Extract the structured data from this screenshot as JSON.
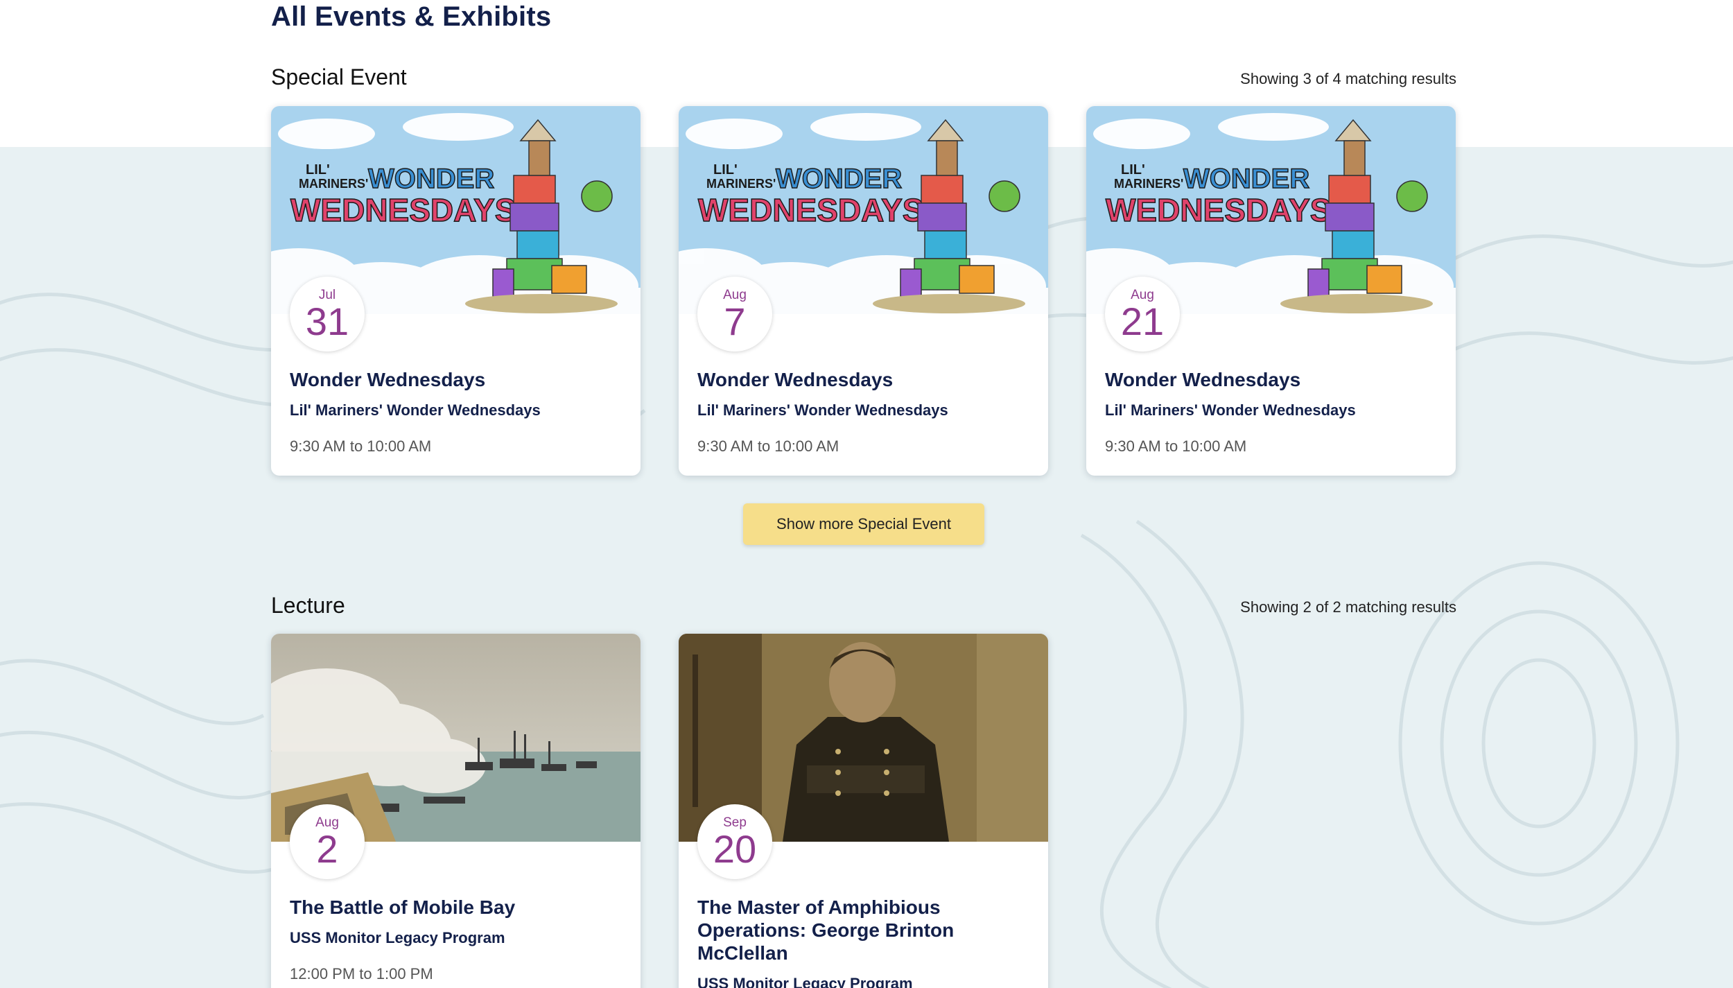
{
  "page_title": "All Events & Exhibits",
  "sections": [
    {
      "title": "Special Event",
      "count_text": "Showing 3 of 4 matching results",
      "show_more_label": "Show more Special Event",
      "cards": [
        {
          "month": "Jul",
          "day": "31",
          "title": "Wonder Wednesdays",
          "subtitle": "Lil' Mariners' Wonder Wednesdays",
          "time": "9:30 AM to 10:00 AM",
          "image_caption_1": "LIL'",
          "image_caption_2": "MARINERS'",
          "image_caption_3": "WONDER",
          "image_caption_4": "WEDNESDAYS"
        },
        {
          "month": "Aug",
          "day": "7",
          "title": "Wonder Wednesdays",
          "subtitle": "Lil' Mariners' Wonder Wednesdays",
          "time": "9:30 AM to 10:00 AM",
          "image_caption_1": "LIL'",
          "image_caption_2": "MARINERS'",
          "image_caption_3": "WONDER",
          "image_caption_4": "WEDNESDAYS"
        },
        {
          "month": "Aug",
          "day": "21",
          "title": "Wonder Wednesdays",
          "subtitle": "Lil' Mariners' Wonder Wednesdays",
          "time": "9:30 AM to 10:00 AM",
          "image_caption_1": "LIL'",
          "image_caption_2": "MARINERS'",
          "image_caption_3": "WONDER",
          "image_caption_4": "WEDNESDAYS"
        }
      ]
    },
    {
      "title": "Lecture",
      "count_text": "Showing 2 of 2 matching results",
      "cards": [
        {
          "month": "Aug",
          "day": "2",
          "title": "The Battle of Mobile Bay",
          "subtitle": "USS Monitor Legacy Program",
          "time": "12:00 PM to 1:00 PM"
        },
        {
          "month": "Sep",
          "day": "20",
          "title": "The Master of Amphibious Operations: George Brinton McClellan",
          "subtitle": "USS Monitor Legacy Program",
          "time": ""
        }
      ]
    }
  ],
  "colors": {
    "accent": "#8e3b8e",
    "button": "#f6de8a",
    "navy": "#13204a",
    "background": "#e8f1f3"
  }
}
